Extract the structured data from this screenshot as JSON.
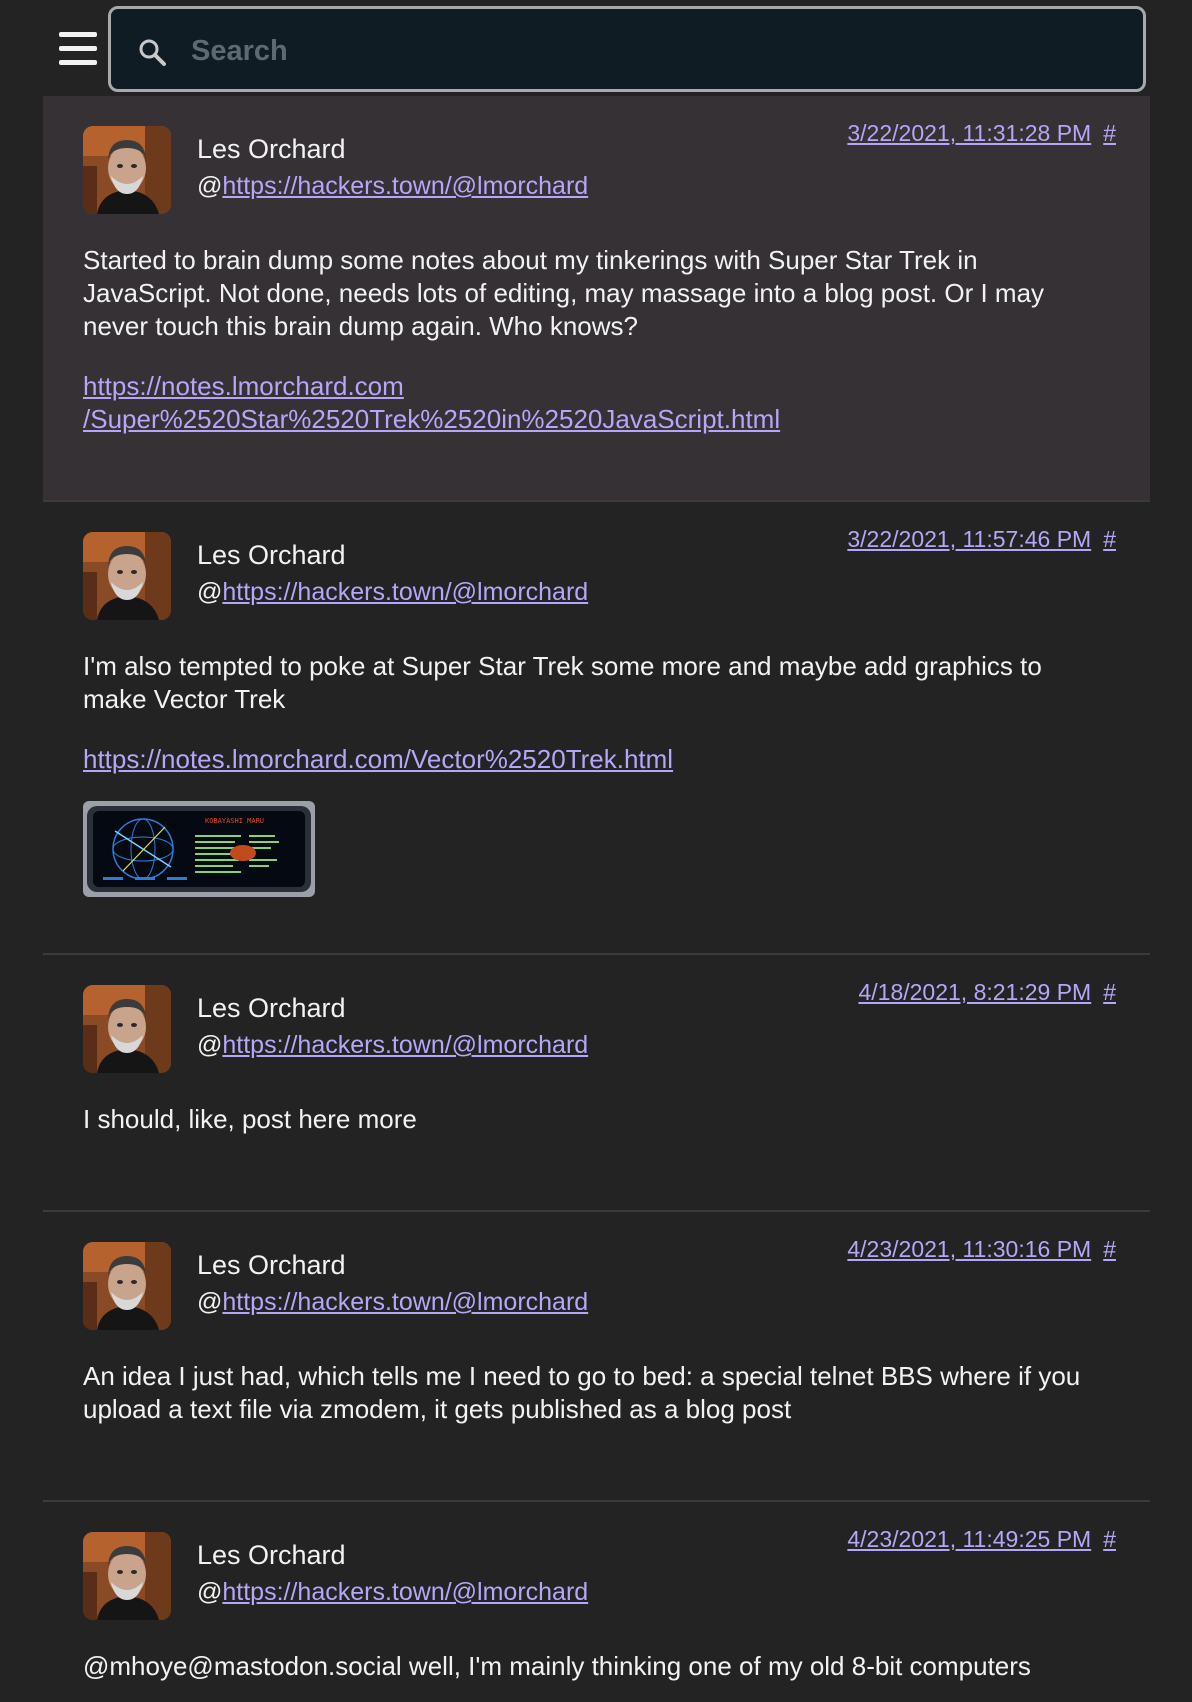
{
  "search": {
    "placeholder": "Search"
  },
  "posts": [
    {
      "author": "Les Orchard",
      "handle_prefix": "@",
      "handle_url": "https://hackers.town/@lmorchard",
      "timestamp": "3/22/2021, 11:31:28 PM",
      "hash": "#",
      "paragraphs": [
        "Started to brain dump some notes about my tinkerings with Super Star Trek in JavaScript. Not done, needs lots of editing, may massage into a blog post. Or I may never touch this brain dump again. Who knows?"
      ],
      "link_line1": "https://notes.lmorchard.com",
      "link_line2": "/Super%2520Star%2520Trek%2520in%2520JavaScript.html"
    },
    {
      "author": "Les Orchard",
      "handle_prefix": "@",
      "handle_url": "https://hackers.town/@lmorchard",
      "timestamp": "3/22/2021, 11:57:46 PM",
      "hash": "#",
      "paragraphs": [
        "I'm also tempted to poke at Super Star Trek some more and maybe add graphics to make Vector Trek"
      ],
      "link": "https://notes.lmorchard.com/Vector%2520Trek.html",
      "image_caption": "KOBAYASHI MARU"
    },
    {
      "author": "Les Orchard",
      "handle_prefix": "@",
      "handle_url": "https://hackers.town/@lmorchard",
      "timestamp": "4/18/2021, 8:21:29 PM",
      "hash": "#",
      "paragraphs": [
        "I should, like, post here more"
      ]
    },
    {
      "author": "Les Orchard",
      "handle_prefix": "@",
      "handle_url": "https://hackers.town/@lmorchard",
      "timestamp": "4/23/2021, 11:30:16 PM",
      "hash": "#",
      "paragraphs": [
        "An idea I just had, which tells me I need to go to bed: a special telnet BBS where if you upload a text file via zmodem, it gets published as a blog post"
      ]
    },
    {
      "author": "Les Orchard",
      "handle_prefix": "@",
      "handle_url": "https://hackers.town/@lmorchard",
      "timestamp": "4/23/2021, 11:49:25 PM",
      "hash": "#",
      "paragraphs": [
        "@mhoye@mastodon.social well, I'm mainly thinking one of my old 8-bit computers"
      ]
    }
  ]
}
